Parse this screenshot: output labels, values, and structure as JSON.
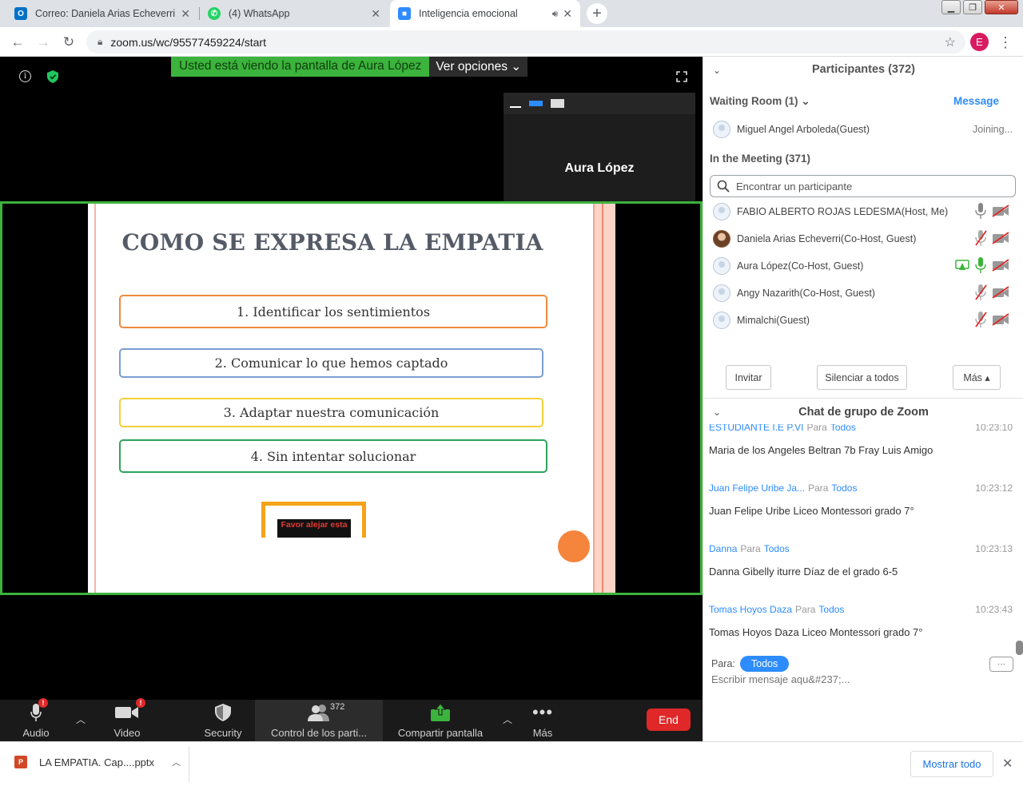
{
  "browser": {
    "tabs": [
      {
        "title": "Correo: Daniela Arias Echeverri -",
        "favicon": "outlook-icon",
        "color": "#0072c6"
      },
      {
        "title": "(4) WhatsApp",
        "favicon": "whatsapp-icon",
        "color": "#25d366"
      },
      {
        "title": "Inteligencia emocional",
        "favicon": "zoom-icon",
        "color": "#2d8cff"
      }
    ],
    "url": "zoom.us/wc/95577459224/start",
    "profile_initial": "E"
  },
  "share": {
    "banner_text": "Usted está viendo la pantalla de Aura López",
    "options_label": "Ver opciones"
  },
  "speaker": {
    "name": "Aura López"
  },
  "slide": {
    "title": "COMO SE EXPRESA LA EMPATIA",
    "items": [
      {
        "text": "1. Identificar los sentimientos",
        "color": "#f08a3c"
      },
      {
        "text": "2. Comunicar lo que hemos captado",
        "color": "#7b9ed1"
      },
      {
        "text": "3. Adaptar nuestra comunicación",
        "color": "#f2d13a"
      },
      {
        "text": "4. Sin intentar solucionar",
        "color": "#2fa35d"
      }
    ],
    "warning_text": "Favor alejar esta"
  },
  "toolbar": {
    "audio": "Audio",
    "video": "Video",
    "security": "Security",
    "participants": "Control de los parti...",
    "participants_count": "372",
    "share": "Compartir pantalla",
    "more": "Más",
    "end": "End"
  },
  "participants": {
    "header": "Participantes (372)",
    "waiting_room": "Waiting Room (1)",
    "message_link": "Message",
    "waiting": {
      "name": "Miguel Angel Arboleda(Guest)",
      "status": "Joining..."
    },
    "in_meeting": "In the Meeting (371)",
    "search_placeholder": "Encontrar un participante",
    "list": [
      {
        "name": "FABIO ALBERTO ROJAS LEDESMA(Host, Me)",
        "mic": "on-gray",
        "video": "off"
      },
      {
        "name": "Daniela Arias Echeverri(Co-Host, Guest)",
        "mic": "muted",
        "video": "off"
      },
      {
        "name": "Aura López(Co-Host, Guest)",
        "mic": "on-green",
        "video": "off",
        "sharing": true
      },
      {
        "name": "Angy Nazarith(Co-Host, Guest)",
        "mic": "muted",
        "video": "off"
      },
      {
        "name": "Mimalchi(Guest)",
        "mic": "muted",
        "video": "off"
      }
    ],
    "invite": "Invitar",
    "mute_all": "Silenciar a todos",
    "more": "Más"
  },
  "chat": {
    "header": "Chat de grupo de Zoom",
    "messages": [
      {
        "from": "ESTUDIANTE I.E P.VI",
        "to_label": "Para",
        "to": "Todos",
        "time": "10:23:10",
        "text": "Maria de los Angeles Beltran 7b Fray Luis Amigo"
      },
      {
        "from": "Juan Felipe Uribe Ja...",
        "to_label": "Para",
        "to": "Todos",
        "time": "10:23:12",
        "text": "Juan Felipe Uribe Liceo Montessori grado 7°"
      },
      {
        "from": "Danna",
        "to_label": "Para",
        "to": "Todos",
        "time": "10:23:13",
        "text": "Danna Gibelly iturre Díaz de el grado 6-5"
      },
      {
        "from": "Tomas Hoyos Daza",
        "to_label": "Para",
        "to": "Todos",
        "time": "10:23:43",
        "text": "Tomas Hoyos Daza Liceo Montessori  grado 7°"
      }
    ],
    "para_label": "Para:",
    "recipient": "Todos",
    "more_label": "···",
    "input_placeholder": "Escribir mensaje aqu&#237;..."
  },
  "downloads": {
    "file": "LA EMPATIA. Cap....pptx",
    "show_all": "Mostrar todo"
  }
}
